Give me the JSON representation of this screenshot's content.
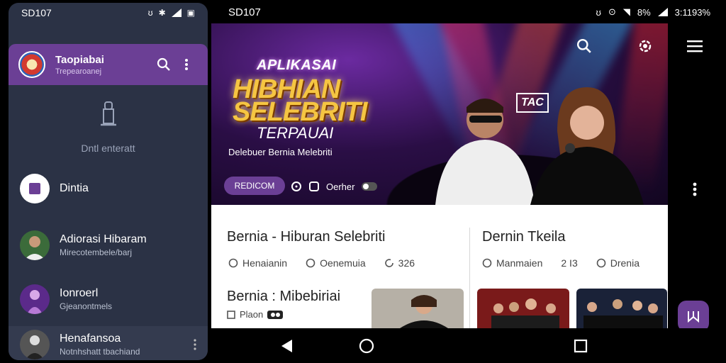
{
  "left_status": {
    "carrier": "SD107"
  },
  "drawer": {
    "app_name": "Taopiabai",
    "app_subtitle": "Trepearoanej",
    "empty_text": "Dntl enteratt",
    "items": [
      {
        "title": "Dintia",
        "subtitle": ""
      },
      {
        "title": "Adiorasi Hibaram",
        "subtitle": "Mirecotembele/barj"
      },
      {
        "title": "Ionroerl",
        "subtitle": "Gjeanontmels"
      },
      {
        "title": "Henafansoa",
        "subtitle": "Notnhshatt tbachiand"
      }
    ]
  },
  "right_status": {
    "carrier": "SD107",
    "battery": "8%",
    "time": "3:1193%"
  },
  "hero": {
    "line1": "APLIKASAI",
    "line2": "HIBHIAN",
    "line3": "SELEBRITI",
    "line4": "TERPAUAI",
    "caption": "Delebuer Bernia Melebriti",
    "chip": "REDICOM",
    "meta_label": "Oerher",
    "sign": "TAC"
  },
  "content": {
    "card1_title": "Bernia - Hiburan Selebriti",
    "card1_meta": [
      "Henaianin",
      "Oenemuia",
      "326"
    ],
    "card2_title": "Dernin Tkeila",
    "card2_meta": [
      "Manmaien",
      "2 I3",
      "Drenia"
    ],
    "card3_title": "Bernia : Mibebiriai",
    "card3_meta": "Plaon"
  },
  "colors": {
    "accent": "#6b3f95",
    "drawer_bg": "#2b3245",
    "gold": "#f5c542"
  }
}
